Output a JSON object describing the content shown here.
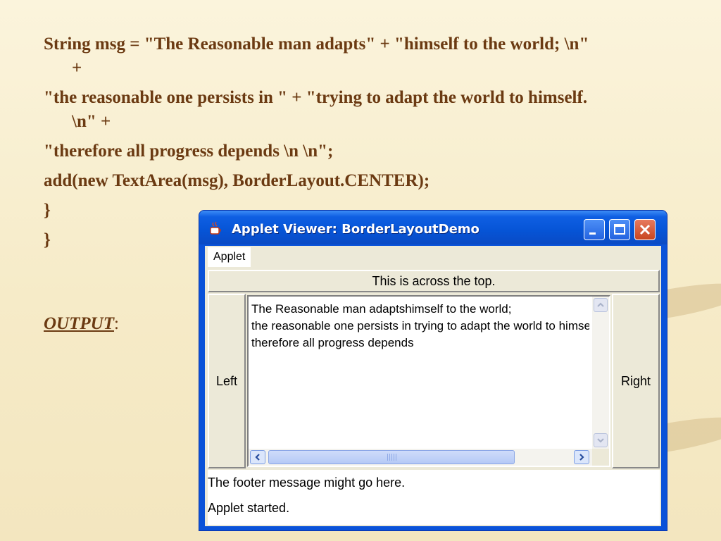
{
  "slide": {
    "code_lines": [
      "String msg = \"The Reasonable man adapts\" + \"himself to the world; \\n\"",
      "+",
      "\"the reasonable one persists in \" + \"trying to adapt the world to himself.",
      "\\n\" +",
      "\"therefore all progress depends \\n \\n\";",
      "add(new TextArea(msg), BorderLayout.CENTER);",
      "}",
      "}"
    ],
    "output_label": "OUTPUT",
    "output_suffix": ":"
  },
  "window": {
    "title": "Applet Viewer: BorderLayoutDemo",
    "menu": "Applet",
    "top_button": "This is across the top.",
    "left_button": "Left",
    "right_button": "Right",
    "textarea_lines": [
      "The Reasonable man adaptshimself to the world;",
      "the reasonable one persists in trying to adapt the world to himself.",
      "therefore all progress depends"
    ],
    "footer": "The footer message might go here.",
    "status": "Applet started."
  },
  "colors": {
    "code_text": "#6b3a12",
    "xp_title_blue": "#0654d6",
    "xp_face": "#ece9d8"
  },
  "icons": [
    "java-cup-icon",
    "minimize-icon",
    "maximize-icon",
    "close-icon",
    "scroll-up-icon",
    "scroll-down-icon",
    "scroll-left-icon",
    "scroll-right-icon"
  ]
}
